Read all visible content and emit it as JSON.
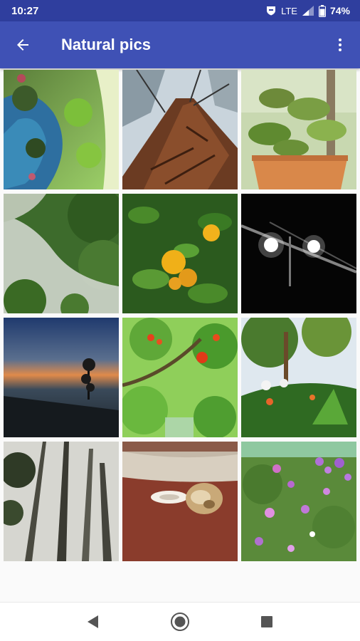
{
  "status_bar": {
    "time": "10:27",
    "network": "LTE",
    "battery": "74%"
  },
  "app_bar": {
    "title": "Natural pics",
    "back_icon": "arrow-back-icon",
    "menu_icon": "more-vert-icon"
  },
  "gallery": {
    "photos": [
      {
        "subject": "lake reflection"
      },
      {
        "subject": "tree trunk looking up"
      },
      {
        "subject": "potted plant"
      },
      {
        "subject": "misty forest"
      },
      {
        "subject": "orange tree"
      },
      {
        "subject": "lights at night"
      },
      {
        "subject": "sunset silhouette tree"
      },
      {
        "subject": "leaves with red berries"
      },
      {
        "subject": "garden flowers"
      },
      {
        "subject": "tall trees in fog"
      },
      {
        "subject": "shell on red rock"
      },
      {
        "subject": "purple flowers"
      }
    ]
  },
  "nav_bar": {
    "back_icon": "nav-back-icon",
    "home_icon": "nav-home-icon",
    "recents_icon": "nav-recents-icon"
  },
  "colors": {
    "status_bar": "#2f3e9e",
    "app_bar": "#3f51b5",
    "background": "#fafafa"
  }
}
